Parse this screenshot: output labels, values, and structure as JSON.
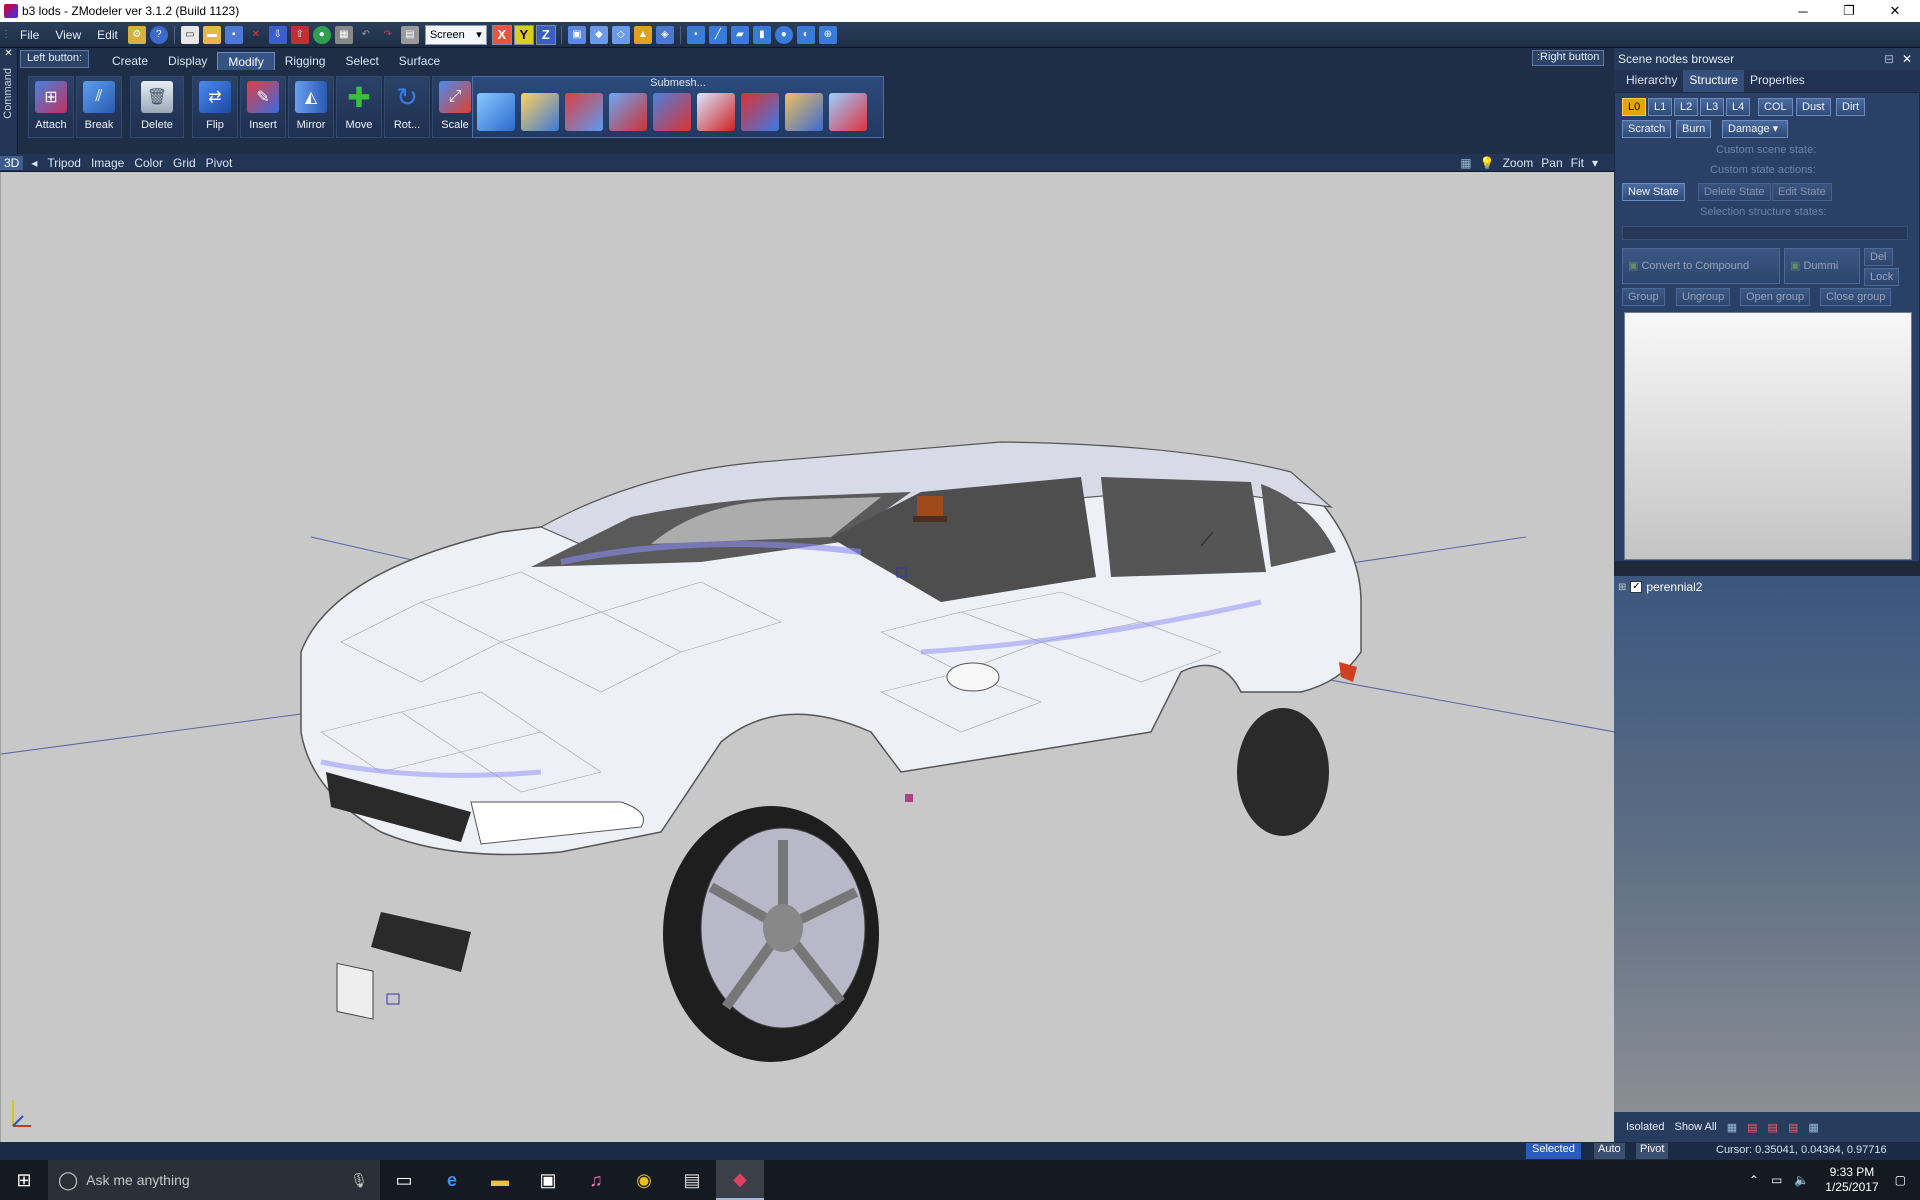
{
  "window": {
    "title": "b3 lods - ZModeler ver 3.1.2 (Build 1123)",
    "minimize": "─",
    "maximize": "❐",
    "close": "✕"
  },
  "menu": {
    "items": [
      "File",
      "View",
      "Edit"
    ],
    "screen_select": "Screen",
    "axes": [
      "X",
      "Y",
      "Z"
    ]
  },
  "command": {
    "sidebar_label": "Command",
    "left_button": "Left button:",
    "right_button": ":Right button",
    "tabs": [
      "Create",
      "Display",
      "Modify",
      "Rigging",
      "Select",
      "Surface"
    ],
    "active_tab": "Modify",
    "tools": [
      "Attach",
      "Break",
      "Delete",
      "Flip",
      "Insert",
      "Mirror",
      "Move",
      "Rot...",
      "Scale"
    ],
    "submesh_label": "Submesh..."
  },
  "viewport": {
    "mode": "3D",
    "menu": [
      "Tripod",
      "Image",
      "Color",
      "Grid",
      "Pivot"
    ],
    "right_tools": [
      "Zoom",
      "Pan",
      "Fit"
    ]
  },
  "scene_browser": {
    "title": "Scene nodes browser",
    "tabs": [
      "Hierarchy",
      "Structure",
      "Properties"
    ],
    "active_tab": "Structure",
    "lod_buttons": [
      "L0",
      "L1",
      "L2",
      "L3",
      "L4",
      "COL",
      "Dust",
      "Dirt"
    ],
    "state_buttons": [
      "Scratch",
      "Burn",
      "Damage"
    ],
    "custom_scene_state": "Custom scene state:",
    "custom_state_actions": "Custom state actions:",
    "new_state": "New State",
    "delete_state": "Delete State",
    "edit_state": "Edit State",
    "selection_structure_states": "Selection structure states:",
    "convert_to_compound": "Convert to Compound",
    "dummies": "Dummi",
    "del": "Del",
    "lock": "Lock",
    "group_buttons": [
      "Group",
      "Ungroup",
      "Open group",
      "Close group"
    ],
    "tree_node": "perennial2",
    "bottom": [
      "Isolated",
      "Show All"
    ]
  },
  "status": {
    "selected": "Selected",
    "auto": "Auto",
    "pivot": "Pivot",
    "cursor": "Cursor: 0.35041, 0.04364, 0.97716"
  },
  "taskbar": {
    "search_placeholder": "Ask me anything",
    "time": "9:33 PM",
    "date": "1/25/2017"
  },
  "colors": {
    "viewport_bg": "#c8c8c8",
    "panel_bg": "#1e2e47",
    "accent_selected": "#e6a400"
  }
}
